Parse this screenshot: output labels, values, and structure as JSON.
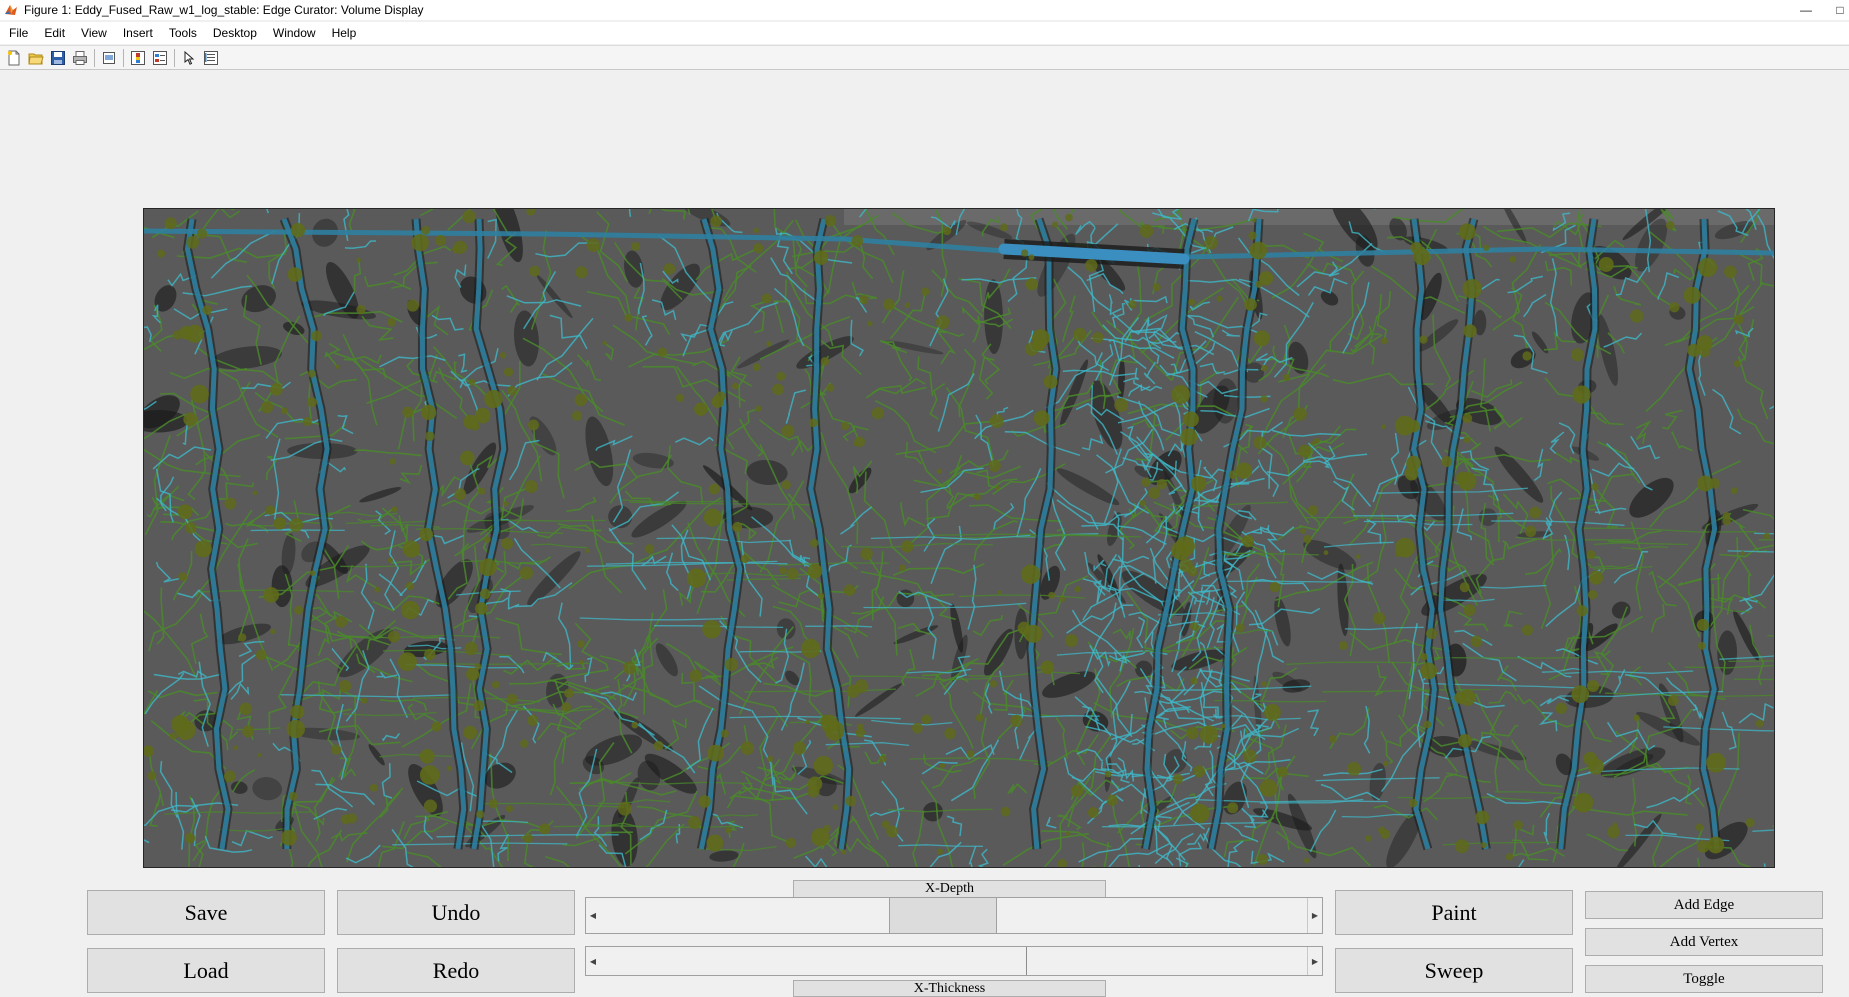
{
  "window": {
    "title": "Figure 1: Eddy_Fused_Raw_w1_log_stable: Edge Curator: Volume Display",
    "app_icon": "matlab-icon",
    "controls": [
      "minimize-icon",
      "maximize-icon"
    ]
  },
  "menu": {
    "items": [
      "File",
      "Edit",
      "View",
      "Insert",
      "Tools",
      "Desktop",
      "Window",
      "Help"
    ]
  },
  "toolbar": {
    "icons": [
      "new-figure-icon",
      "open-file-icon",
      "save-icon",
      "print-icon",
      "print-preview-icon",
      "colorbar-icon",
      "legend-icon",
      "select-pointer-icon",
      "property-inspector-icon"
    ]
  },
  "display": {
    "colors": {
      "background": "#5a5a5a",
      "dark_vessel": "#1a1a1a",
      "network_green": "#4a8a2a",
      "network_cyan": "#3fb8c8",
      "network_teal": "#2f7fa0",
      "vertex_olive": "#5f6a1a"
    }
  },
  "controls": {
    "save": "Save",
    "load": "Load",
    "undo": "Undo",
    "redo": "Redo",
    "paint": "Paint",
    "sweep": "Sweep",
    "add_edge": "Add Edge",
    "add_vertex": "Add Vertex",
    "toggle": "Toggle",
    "depth_label": "X-Depth",
    "thickness_label": "X-Thickness",
    "depth_slider_position": 0.48,
    "thickness_slider_position": 0.6
  }
}
